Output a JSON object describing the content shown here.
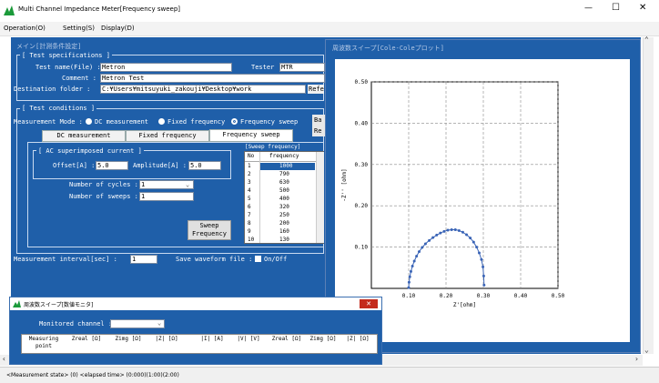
{
  "window": {
    "title": "Multi Channel Impedance Meter[Frequency sweep]",
    "min": "—",
    "max": "☐",
    "close": "✕"
  },
  "menu": {
    "operation": "Operation(O)",
    "setting": "Setting(S)",
    "display": "Display(D)"
  },
  "main": {
    "window_label": "メイン[計測条件設定]",
    "test_spec": {
      "group": "[ Test specifications ]",
      "file_label": "Test name(File) :",
      "file_value": "Metron",
      "tester_label": "Tester :",
      "tester_value": "MTR",
      "comment_label": "Comment :",
      "comment_value": "Metron Test",
      "dest_label": "Destination folder :",
      "dest_value": "C:¥Users¥mitsuyuki_zakouji¥Desktop¥work",
      "ref_button": "Refe"
    },
    "test_cond": {
      "group": "[ Test conditions ]",
      "mode_label": "Measurement Mode :",
      "mode_dc": "DC measurement",
      "mode_fixed": "Fixed frequency",
      "mode_sweep": "Frequency sweep",
      "side_btn1": "Ba",
      "side_btn2": "Re"
    },
    "tabs": [
      "DC measurement",
      "Fixed frequency",
      "Frequency sweep"
    ],
    "ac": {
      "group": "[ AC superimposed current ]",
      "offset_label": "Offset[A] :",
      "offset_value": "5.0",
      "amp_label": "Amplitude[A] :",
      "amp_value": "5.0",
      "cycles_label": "Number of cycles :",
      "cycles_value": "1",
      "sweeps_label": "Number of sweeps :",
      "sweeps_value": "1"
    },
    "sweep_btn_line1": "Sweep",
    "sweep_btn_line2": "Frequency",
    "sweep_table": {
      "title": "[Sweep frequency]",
      "col_no": "No",
      "col_freq": "frequency",
      "rows": [
        [
          "1",
          "1000"
        ],
        [
          "2",
          "790"
        ],
        [
          "3",
          "630"
        ],
        [
          "4",
          "500"
        ],
        [
          "5",
          "400"
        ],
        [
          "6",
          "320"
        ],
        [
          "7",
          "250"
        ],
        [
          "8",
          "200"
        ],
        [
          "9",
          "160"
        ],
        [
          "10",
          "130"
        ]
      ]
    },
    "interval_label": "Measurement interval[sec] :",
    "interval_value": "1",
    "save_label": "Save waveform file :",
    "save_value": "On/Off"
  },
  "cole": {
    "title": "周波数スイープ[Cole-Coleプロット]"
  },
  "chart_data": {
    "type": "scatter",
    "xlabel": "Z'[ohm]",
    "ylabel": "-Z'' [ohm]",
    "xlim": [
      0.0,
      0.5
    ],
    "ylim": [
      0.0,
      0.5
    ],
    "xticks": [
      "0.10",
      "0.20",
      "0.30",
      "0.40",
      "0.50"
    ],
    "yticks": [
      "0.10",
      "0.20",
      "0.30",
      "0.40",
      "0.50"
    ],
    "grid": true,
    "x": [
      0.1,
      0.101,
      0.103,
      0.106,
      0.11,
      0.115,
      0.121,
      0.128,
      0.136,
      0.145,
      0.155,
      0.165,
      0.175,
      0.185,
      0.195,
      0.205,
      0.215,
      0.225,
      0.235,
      0.245,
      0.255,
      0.265,
      0.274,
      0.282,
      0.289,
      0.295,
      0.299,
      0.301,
      0.302
    ],
    "y": [
      0.002,
      0.015,
      0.028,
      0.041,
      0.054,
      0.066,
      0.078,
      0.089,
      0.099,
      0.108,
      0.116,
      0.123,
      0.129,
      0.134,
      0.138,
      0.141,
      0.142,
      0.142,
      0.14,
      0.136,
      0.13,
      0.122,
      0.112,
      0.1,
      0.086,
      0.07,
      0.052,
      0.03,
      0.008
    ]
  },
  "monitor": {
    "title": "周波数スイープ[数値モニタ]",
    "close": "✕",
    "channel_label": "Monitored channel :",
    "headers": [
      "Measuring point",
      "Zreal [Ω]",
      "Zimg [Ω]",
      "|Z| [Ω]",
      "|I| [A]",
      "|V| [V]",
      "Zreal [Ω]",
      "Zimg [Ω]",
      "|Z| [Ω]"
    ]
  },
  "status": {
    "text": "<Measurement state> (0)  <elapsed time> (0:000)(1:00)(2:00)"
  }
}
